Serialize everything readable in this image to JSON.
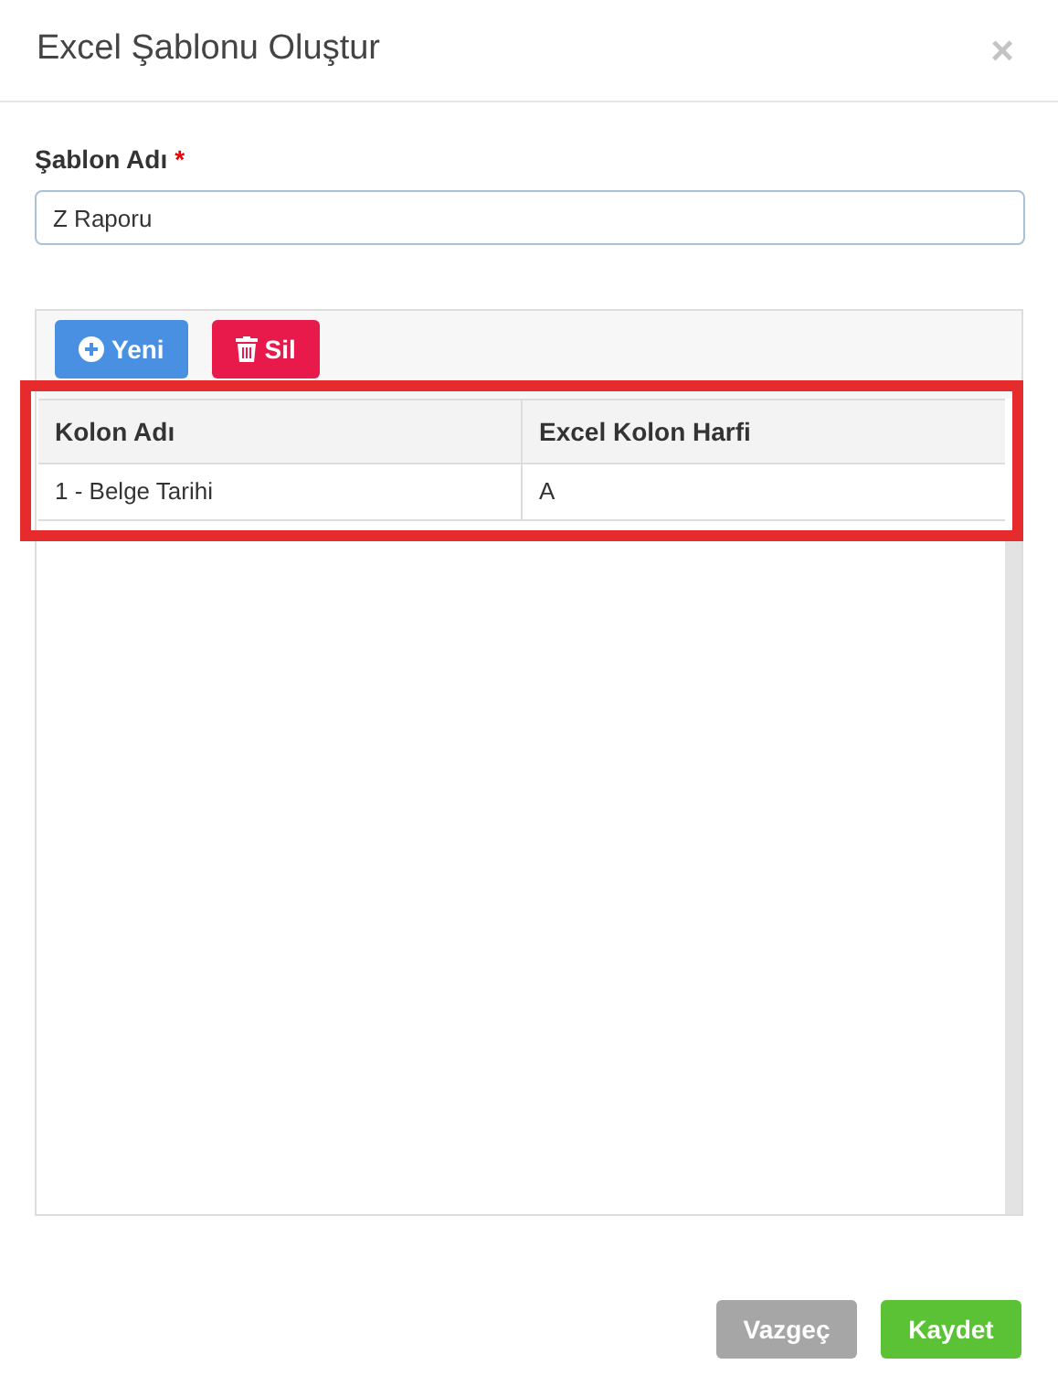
{
  "dialog": {
    "title": "Excel Şablonu Oluştur",
    "close": "×"
  },
  "form": {
    "label": "Şablon Adı",
    "required_mark": "*",
    "value": "Z Raporu"
  },
  "toolbar": [
    {
      "label": "Yeni",
      "kind": "add"
    },
    {
      "label": "Sil",
      "kind": "delete"
    }
  ],
  "table": {
    "columns": [
      "Kolon Adı",
      "Excel Kolon Harfi"
    ],
    "rows": [
      [
        "1 - Belge Tarihi",
        "A"
      ]
    ],
    "highlighted": true
  },
  "buttons": [
    {
      "label": "Vazgeç",
      "kind": "cancel"
    },
    {
      "label": "Kaydet",
      "kind": "save"
    }
  ]
}
